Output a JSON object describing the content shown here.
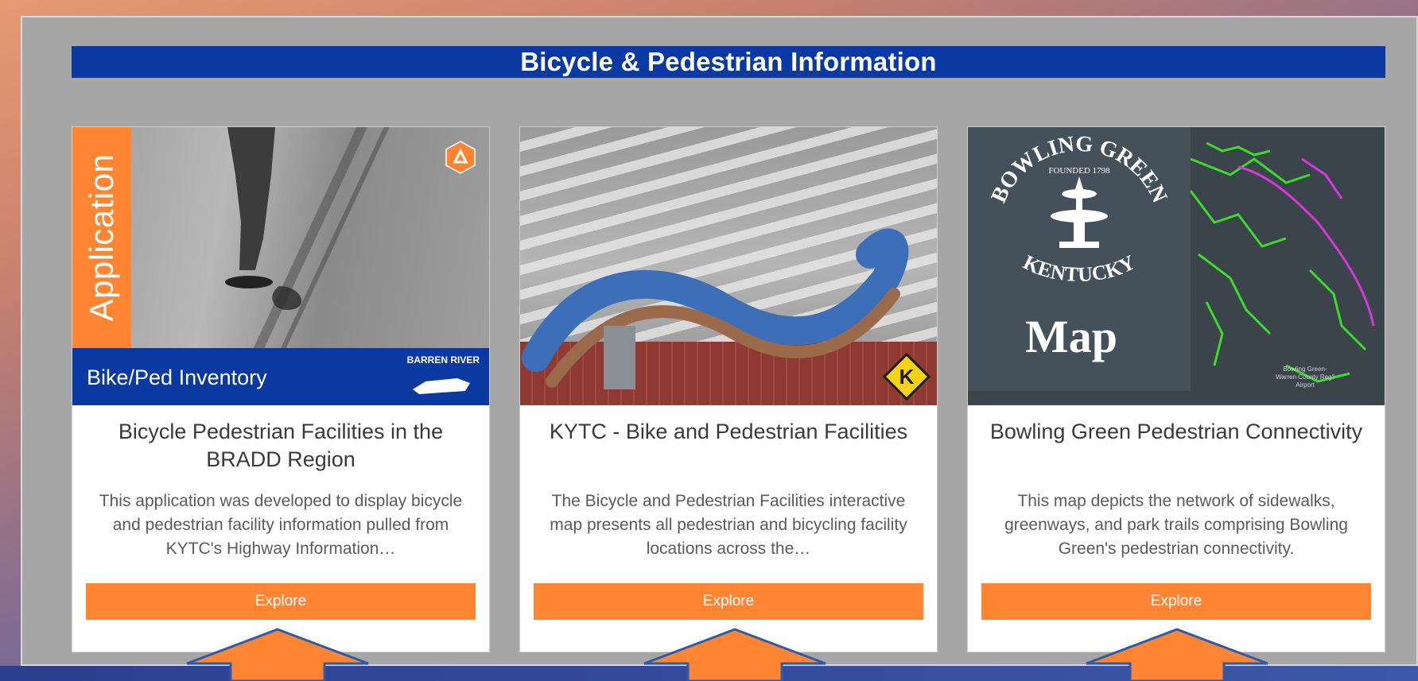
{
  "banner": {
    "title": "Bicycle & Pedestrian Information"
  },
  "cards": [
    {
      "title": "Bicycle Pedestrian Facilities in the BRADD Region",
      "description": "This application was developed to display bicycle and pedestrian facility information pulled from KYTC's Highway Information…",
      "button": "Explore",
      "thumb": {
        "vertical_label": "Application",
        "bar_label": "Bike/Ped Inventory",
        "org_label": "BARREN RIVER"
      }
    },
    {
      "title": "KYTC - Bike and Pedestrian Facilities",
      "description": "The Bicycle and Pedestrian Facilities interactive map presents all pedestrian and bicycling facility locations across the…",
      "button": "Explore",
      "thumb": {
        "badge_letter": "K"
      }
    },
    {
      "title": "Bowling Green Pedestrian Connectivity",
      "description": "This map depicts the network of sidewalks, greenways, and park trails comprising Bowling Green's pedestrian connectivity.",
      "button": "Explore",
      "thumb": {
        "overlay_label": "Map",
        "seal_top": "BOWLING GREEN",
        "seal_founded": "FOUNDED 1798",
        "seal_bottom": "KENTUCKY",
        "note": "Bowling Green-Warren County Reg'l Airport"
      }
    }
  ],
  "colors": {
    "banner": "#0a3aa1",
    "button": "#ff8532",
    "arrow": "#ff8532",
    "arrow_outline": "#2f5aa8"
  }
}
